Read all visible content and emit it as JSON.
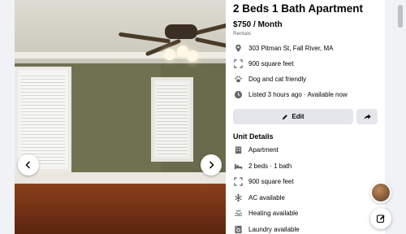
{
  "listing": {
    "title": "2 Beds 1 Bath Apartment",
    "price": "$750 / Month",
    "category": "Rentals"
  },
  "info": [
    {
      "icon": "location-pin-icon",
      "text": "303 Pitman St, Fall River, MA"
    },
    {
      "icon": "square-feet-icon",
      "text": "900 square feet"
    },
    {
      "icon": "paw-icon",
      "text": "Dog and cat friendly"
    },
    {
      "icon": "clock-icon",
      "text": "Listed 3 hours ago · Available now"
    }
  ],
  "actions": {
    "edit_label": "Edit",
    "share_icon": "share-arrow-icon"
  },
  "unit_details": {
    "heading": "Unit Details",
    "items": [
      {
        "icon": "apartment-icon",
        "text": "Apartment"
      },
      {
        "icon": "bed-icon",
        "text": "2 beds · 1 bath"
      },
      {
        "icon": "square-feet-icon",
        "text": "900 square feet"
      },
      {
        "icon": "snowflake-icon",
        "text": "AC available"
      },
      {
        "icon": "heating-icon",
        "text": "Heating available"
      },
      {
        "icon": "laundry-icon",
        "text": "Laundry available"
      }
    ]
  },
  "gallery": {
    "prev_icon": "chevron-left-icon",
    "next_icon": "chevron-right-icon"
  },
  "colors": {
    "panel_bg": "#ffffff",
    "page_bg": "#f0f2f5",
    "button_bg": "#e4e6eb",
    "muted_text": "#65676b"
  }
}
